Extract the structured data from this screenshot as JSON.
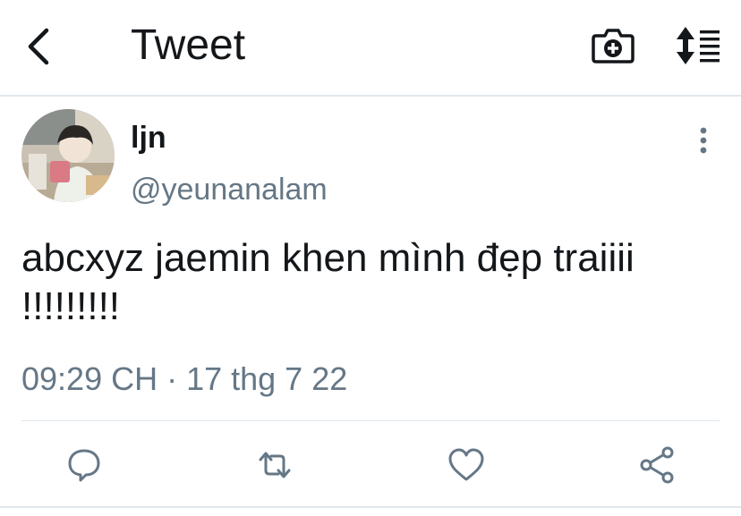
{
  "header": {
    "title": "Tweet",
    "icons": {
      "back": "chevron-left-icon",
      "camera": "camera-plus-icon",
      "sort": "sort-list-icon"
    }
  },
  "tweet": {
    "display_name": "ljn",
    "handle": "@yeunanalam",
    "text": "abcxyz jaemin khen mình đẹp traiiii !!!!!!!!!",
    "timestamp": "09:29 CH · 17 thg 7 22"
  },
  "actions": {
    "icons": [
      "reply-icon",
      "retweet-icon",
      "like-icon",
      "share-icon"
    ]
  },
  "colors": {
    "text": "#14171a",
    "secondary": "#657786",
    "icon": "#657786",
    "divider": "#e1e8ed"
  }
}
